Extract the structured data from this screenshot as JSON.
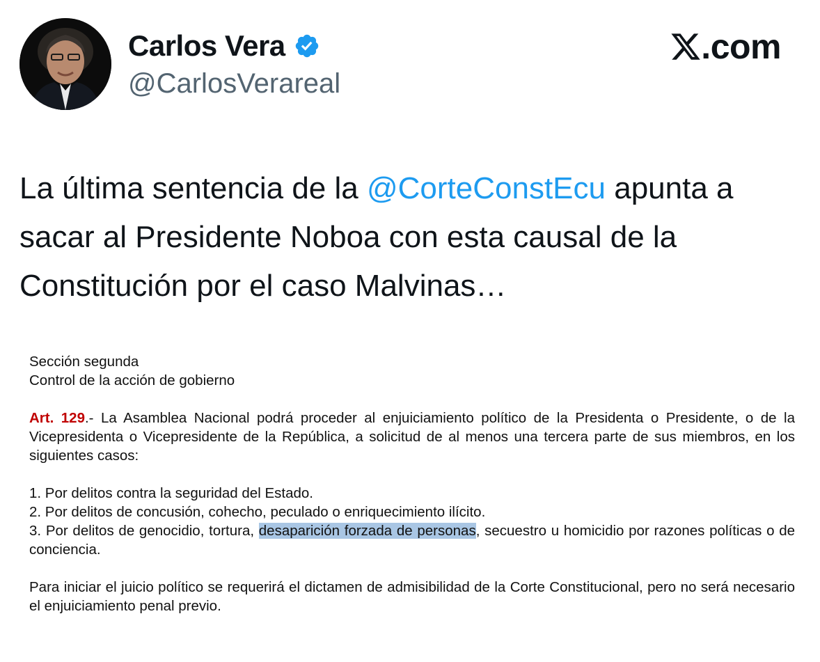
{
  "author": {
    "display_name": "Carlos Vera",
    "handle": "@CarlosVerareal",
    "verified": true,
    "avatar_icon": "profile-photo-avatar"
  },
  "watermark": {
    "logo_icon": "x-logo-icon",
    "text": ".com"
  },
  "tweet": {
    "text_before": "La última sentencia de la ",
    "mention": "@CorteConstEcu",
    "text_after": " apunta a sacar al Presidente Noboa con esta causal de la Constitución por el caso Malvinas…"
  },
  "document": {
    "section_title": "Sección segunda",
    "section_subtitle": "Control de la acción de gobierno",
    "article_label": "Art. 129",
    "article_text": ".- La Asamblea Nacional podrá proceder al enjuiciamiento político de la Presidenta o Presidente, o de la Vicepresidenta o Vicepresidente de la República, a solicitud de al menos una tercera parte de sus miembros, en los siguientes casos:",
    "case_1": "1. Por delitos contra la seguridad del Estado.",
    "case_2": "2. Por delitos de concusión, cohecho, peculado o enriquecimiento ilícito.",
    "case_3_before": "3. Por delitos de genocidio, tortura, ",
    "case_3_highlight": "desaparición forzada de personas",
    "case_3_after": ", secuestro u homicidio por razones políticas o de conciencia.",
    "closing": "Para iniciar el juicio político se requerirá el dictamen de admisibilidad de la Corte Constitucional, pero no será necesario el enjuiciamiento penal previo."
  },
  "colors": {
    "mention": "#1d9bf0",
    "verified_badge": "#1d9bf0",
    "article_label": "#c00000",
    "highlight": "#a9c6e4",
    "handle": "#536471"
  }
}
